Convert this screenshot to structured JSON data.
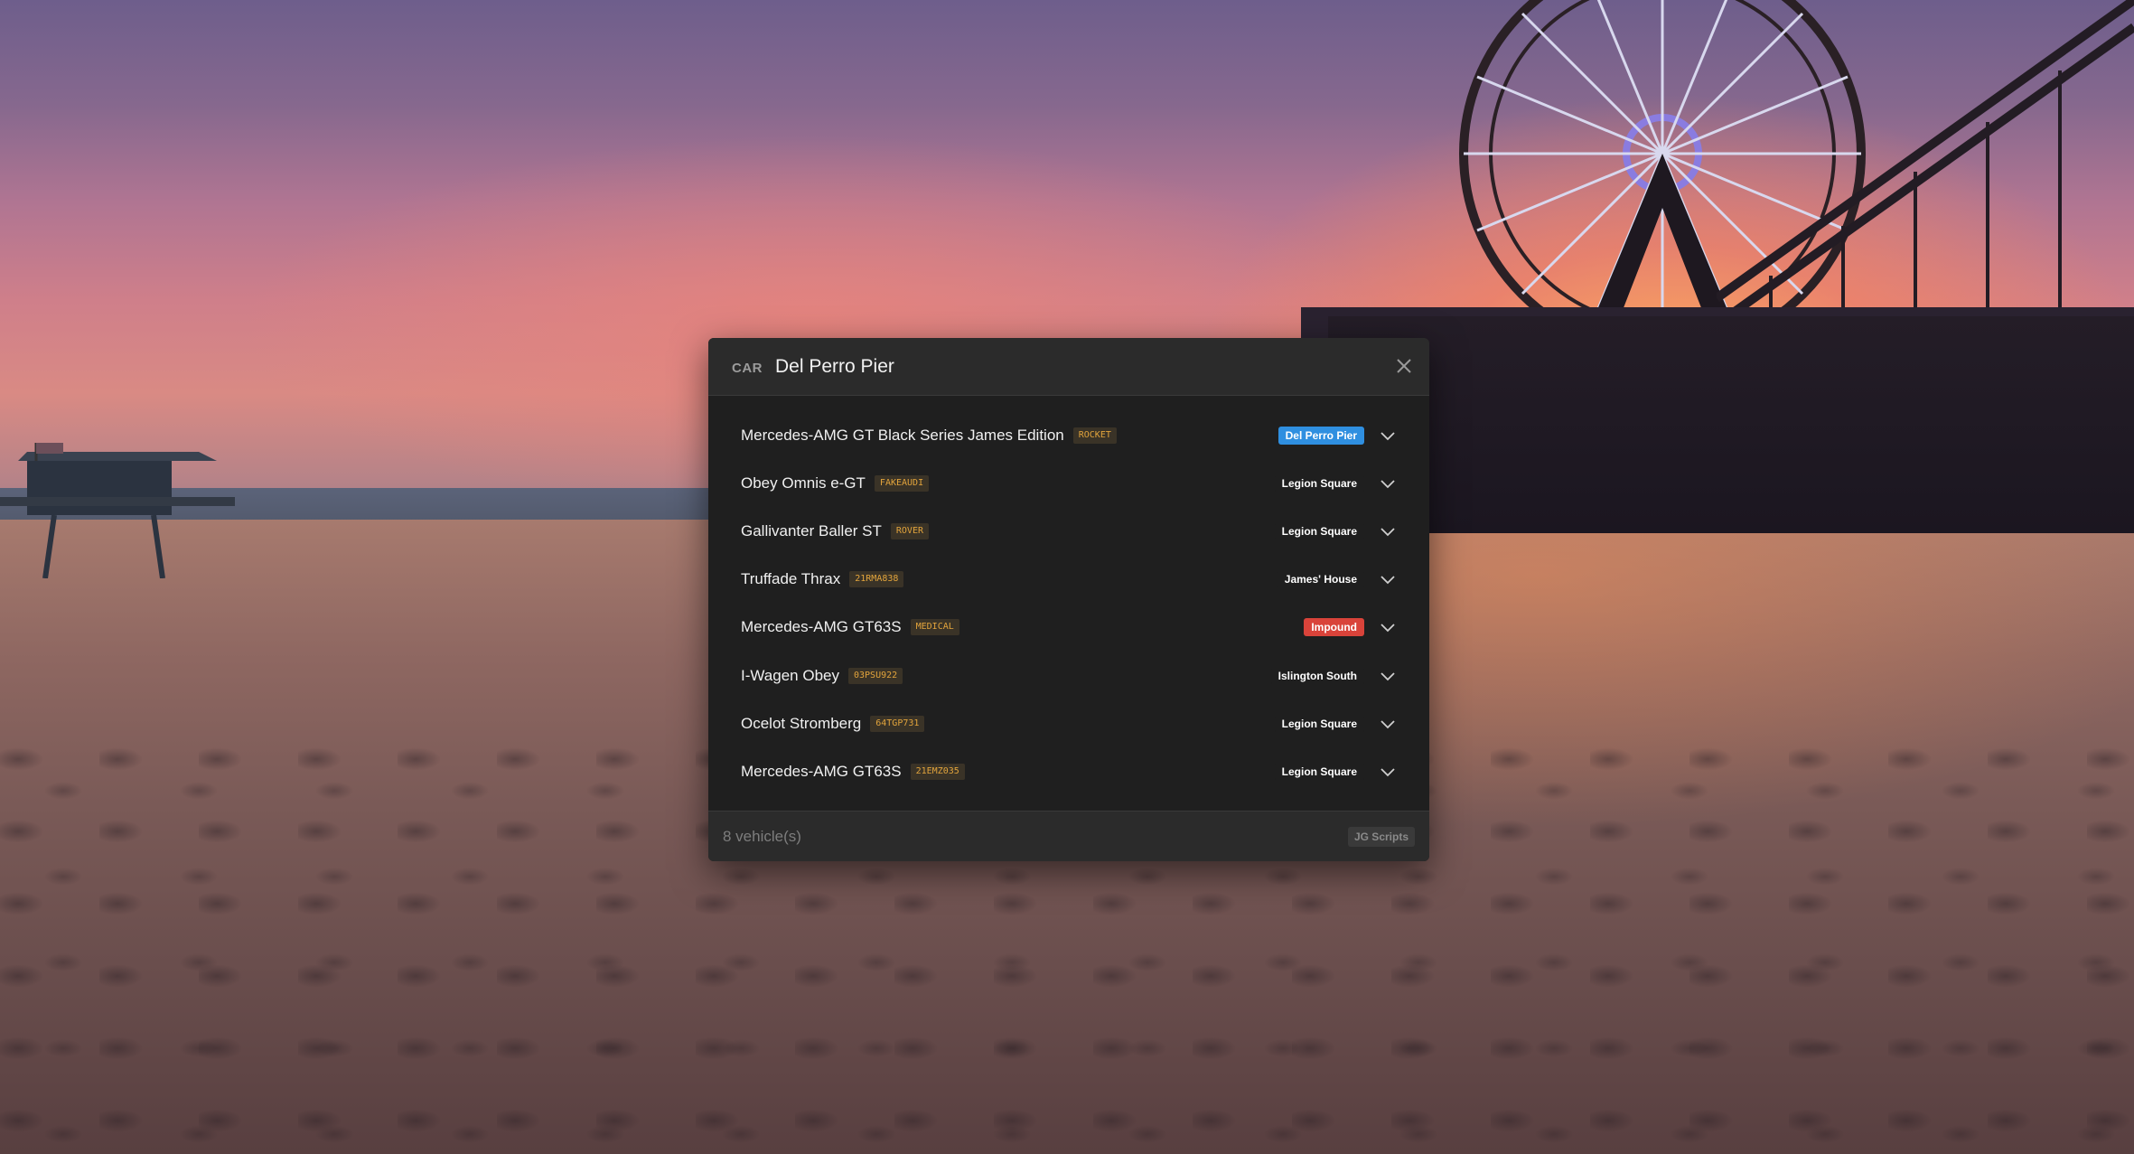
{
  "header": {
    "type_label": "CAR",
    "title": "Del Perro Pier",
    "close_icon": "close-icon"
  },
  "vehicles": [
    {
      "name": "Mercedes-AMG GT Black Series James Edition",
      "plate": "ROCKET",
      "location": "Del Perro Pier",
      "location_color": "#2f8fe0"
    },
    {
      "name": "Obey Omnis e-GT",
      "plate": "FAKEAUDI",
      "location": "Legion Square",
      "location_color": "#1f1f1f"
    },
    {
      "name": "Gallivanter Baller ST",
      "plate": "ROVER",
      "location": "Legion Square",
      "location_color": "#1f1f1f"
    },
    {
      "name": "Truffade Thrax",
      "plate": "21RMA838",
      "location": "James' House",
      "location_color": "#1f1f1f"
    },
    {
      "name": "Mercedes-AMG GT63S",
      "plate": "MEDICAL",
      "location": "Impound",
      "location_color": "#d9433a"
    },
    {
      "name": "I-Wagen Obey",
      "plate": "03PSU922",
      "location": "Islington South",
      "location_color": "#1f1f1f"
    },
    {
      "name": "Ocelot Stromberg",
      "plate": "64TGP731",
      "location": "Legion Square",
      "location_color": "#1f1f1f"
    },
    {
      "name": "Mercedes-AMG GT63S",
      "plate": "21EMZ035",
      "location": "Legion Square",
      "location_color": "#1f1f1f"
    }
  ],
  "footer": {
    "count_text": "8 vehicle(s)",
    "brand": "JG Scripts"
  },
  "colors": {
    "modal_bg": "#1f1f1f",
    "header_bg": "#2b2b2b",
    "plate_text": "#e2a43c",
    "accent_blue": "#2f8fe0",
    "accent_red": "#d9433a"
  }
}
